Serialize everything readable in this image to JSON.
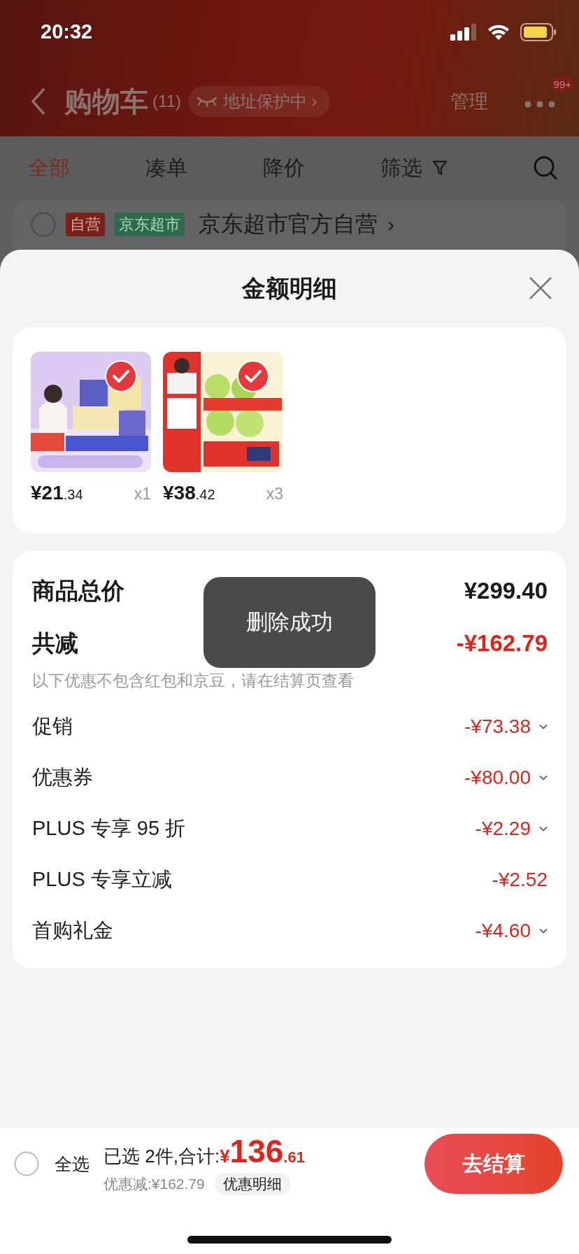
{
  "status_bar": {
    "time": "20:32"
  },
  "header": {
    "title": "购物车",
    "count": "(11)",
    "address_badge": "地址保护中",
    "address_arrow": "›",
    "manage": "管理",
    "more_badge": "99+"
  },
  "tabs": [
    {
      "label": "全部",
      "selected": true
    },
    {
      "label": "凑单",
      "selected": false
    },
    {
      "label": "降价",
      "selected": false
    },
    {
      "label": "筛选",
      "selected": false,
      "kind": "filter"
    }
  ],
  "store": {
    "checked": false,
    "tags": [
      {
        "label": "自营",
        "color": "#7a2019"
      },
      {
        "label": "京东超市",
        "color": "#2f6a4e"
      }
    ],
    "name": "京东超市官方自营",
    "arrow": "›"
  },
  "sheet": {
    "title": "金额明细",
    "products": [
      {
        "price": "¥21.34",
        "quantity": "x1",
        "selected": true
      },
      {
        "price": "¥38.42",
        "quantity": "x3",
        "selected": true
      }
    ],
    "total": {
      "label": "商品总价",
      "amount": "¥299.40"
    },
    "reduction": {
      "label": "共减",
      "amount": "-¥162.79",
      "note": "以下优惠不包含红包和京豆，请在结算页查看"
    },
    "discounts": [
      {
        "label": "促销",
        "amount": "-¥73.38",
        "expandable": true
      },
      {
        "label": "优惠券",
        "amount": "-¥80.00",
        "expandable": true
      },
      {
        "label": "PLUS 专享 95 折",
        "amount": "-¥2.29",
        "expandable": true
      },
      {
        "label": "PLUS 专享立减",
        "amount": "-¥2.52",
        "expandable": false
      },
      {
        "label": "首购礼金",
        "amount": "-¥4.60",
        "expandable": true
      }
    ],
    "toast": "删除成功"
  },
  "checkout": {
    "select_all": {
      "label": "全选",
      "checked": false
    },
    "selected_text": "已选 2件,合计:",
    "currency": "¥",
    "total": "136.61",
    "saving": "优惠减:¥162.79",
    "detail_link": "优惠明细",
    "button": "去结算"
  }
}
